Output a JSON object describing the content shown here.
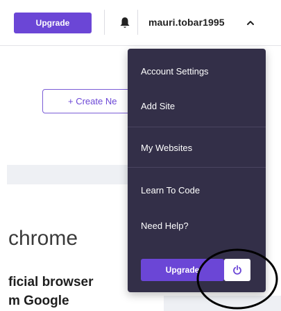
{
  "header": {
    "upgrade_label": "Upgrade",
    "username": "mauri.tobar1995"
  },
  "main": {
    "create_label": "+ Create Ne",
    "chrome_text": "chrome",
    "headline_line1": "ficial browser",
    "headline_line2": "m Google"
  },
  "dropdown": {
    "items": [
      {
        "label": "Account Settings"
      },
      {
        "label": "Add Site"
      },
      {
        "label": "My Websites"
      },
      {
        "label": "Learn To Code"
      },
      {
        "label": "Need Help?"
      }
    ],
    "upgrade_label": "Upgrade"
  },
  "colors": {
    "accent": "#6b46d6",
    "dropdown_bg": "#332f48"
  },
  "icons": [
    "bell-icon",
    "chevron-up-icon",
    "power-icon"
  ]
}
